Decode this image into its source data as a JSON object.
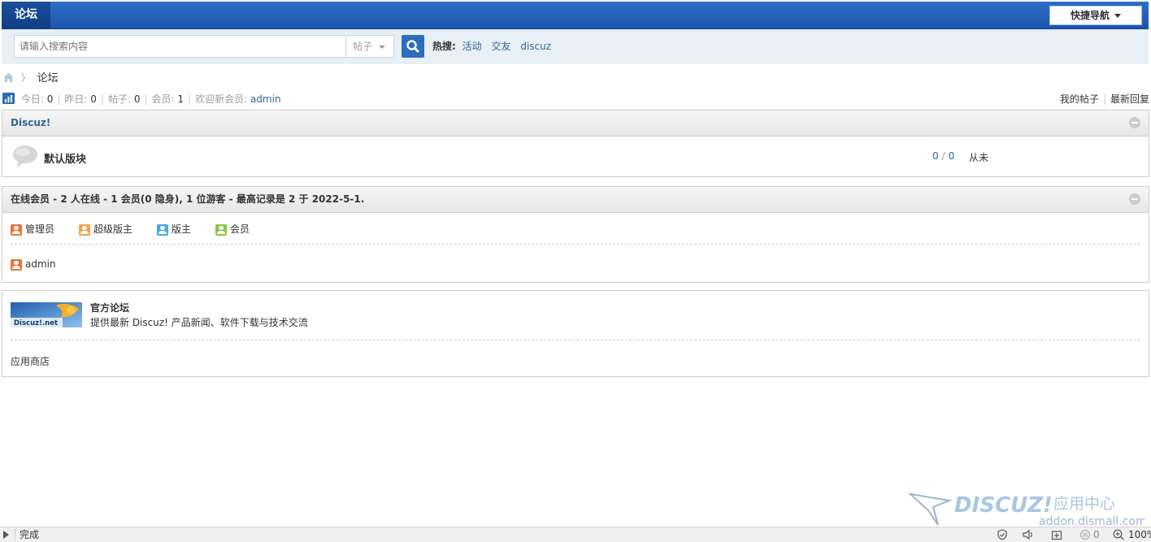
{
  "topbar": {
    "tab": "论坛",
    "quick_nav": "快捷导航"
  },
  "search": {
    "placeholder": "请输入搜索内容",
    "type": "帖子",
    "hot_label": "热搜:",
    "hot_terms": [
      "活动",
      "交友",
      "discuz"
    ]
  },
  "breadcrumb": {
    "current": "论坛"
  },
  "stats": {
    "today_label": "今日:",
    "today": "0",
    "yesterday_label": "昨日:",
    "yesterday": "0",
    "posts_label": "帖子:",
    "posts": "0",
    "members_label": "会员:",
    "members": "1",
    "newest_label": "欢迎新会员:",
    "newest": "admin",
    "my_posts": "我的帖子",
    "latest_reply": "最新回复"
  },
  "category": {
    "title": "Discuz!",
    "forum": {
      "name": "默认版块",
      "threads": "0",
      "posts": "0",
      "last_post": "从未"
    }
  },
  "online": {
    "title": "在线会员 - 2 人在线 - 1 会员(0 隐身), 1 位游客 - 最高记录是 2 于 2022-5-1.",
    "legend": [
      {
        "label": "管理员",
        "color": "#e8743b"
      },
      {
        "label": "超级版主",
        "color": "#f0a54a"
      },
      {
        "label": "版主",
        "color": "#4aa8e0"
      },
      {
        "label": "会员",
        "color": "#8cc63e"
      }
    ],
    "members": [
      {
        "name": "admin",
        "color": "#e8743b"
      }
    ]
  },
  "links": {
    "logo_text": "Discuz!.net",
    "title": "官方论坛",
    "desc": "提供最新 Discuz! 产品新闻、软件下载与技术交流",
    "store": "应用商店"
  },
  "watermark": {
    "brand": "DISCUZ!",
    "suffix": "应用中心",
    "url": "addon.dismall.com"
  },
  "statusbar": {
    "status": "完成",
    "counter": "0",
    "zoom": "100%"
  }
}
